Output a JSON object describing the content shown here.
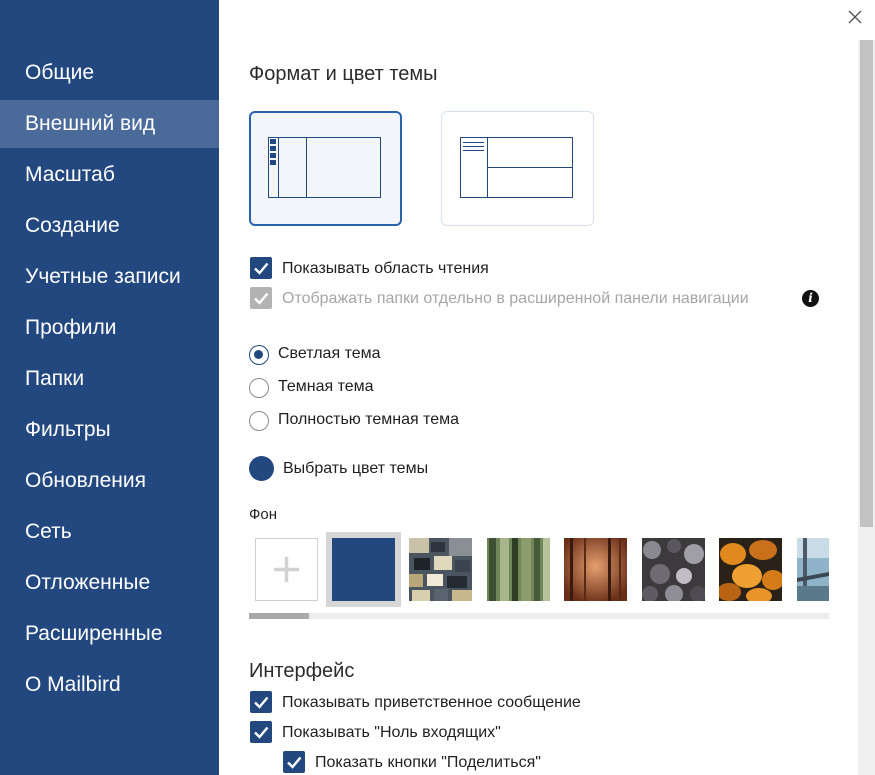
{
  "sidebar": {
    "items": [
      {
        "label": "Общие"
      },
      {
        "label": "Внешний вид",
        "active": true
      },
      {
        "label": "Масштаб"
      },
      {
        "label": "Создание"
      },
      {
        "label": "Учетные записи"
      },
      {
        "label": "Профили"
      },
      {
        "label": "Папки"
      },
      {
        "label": "Фильтры"
      },
      {
        "label": "Обновления"
      },
      {
        "label": "Сеть"
      },
      {
        "label": "Отложенные"
      },
      {
        "label": "Расширенные"
      },
      {
        "label": "О Mailbird"
      }
    ]
  },
  "main": {
    "layout_title": "Формат и цвет темы",
    "layout_options": [
      "layout-sidebar-reading-pane",
      "layout-stacked-panes"
    ],
    "selected_layout": 0,
    "checkboxes": [
      {
        "label": "Показывать область чтения",
        "checked": true,
        "disabled": false
      },
      {
        "label": "Отображать папки отдельно в расширенной панели навигации",
        "checked": true,
        "disabled": true
      }
    ],
    "themes": [
      {
        "label": "Светлая тема",
        "selected": true
      },
      {
        "label": "Темная тема",
        "selected": false
      },
      {
        "label": "Полностью темная тема",
        "selected": false
      }
    ],
    "theme_color_label": "Выбрать цвет темы",
    "background_label": "Фон",
    "backgrounds": [
      "add-background",
      "solid-blue",
      "foliage-pattern",
      "bamboo-forest",
      "autumn-forest",
      "dark-foliage",
      "pumpkins",
      "bridge"
    ],
    "selected_background": 1,
    "interface_title": "Интерфейс",
    "interface_options": [
      {
        "label": "Показывать приветственное сообщение",
        "checked": true
      },
      {
        "label": "Показывать \"Ноль входящих\"",
        "checked": true
      },
      {
        "label": "Показать кнопки \"Поделиться\"",
        "checked": true
      }
    ]
  },
  "colors": {
    "sidebar_bg": "#22487f",
    "sidebar_active": "#4a6b9a",
    "accent": "#22487f",
    "card_selected_border": "#2a62ad",
    "disabled": "#b3b3b3"
  },
  "icons": [
    "close-icon",
    "checkmark-icon",
    "info-icon",
    "plus-icon"
  ]
}
